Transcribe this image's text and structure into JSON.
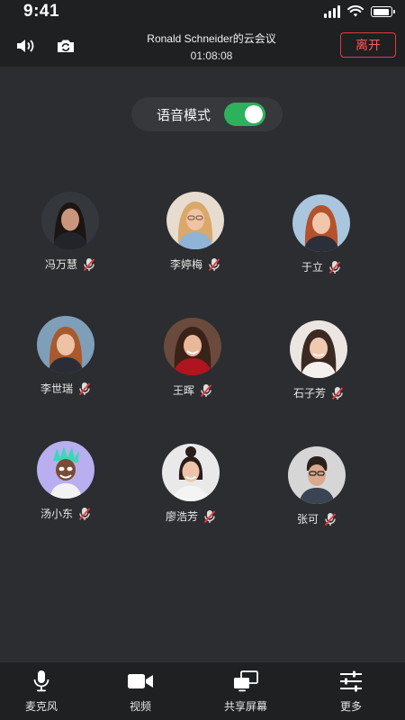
{
  "status_bar": {
    "time": "9:41"
  },
  "header": {
    "title": "Ronald Schneider的云会议",
    "timer": "01:08:08",
    "leave_label": "离开",
    "left_icons": [
      "speaker-icon",
      "switch-camera-icon"
    ]
  },
  "voice_mode": {
    "label": "语音模式",
    "enabled": true
  },
  "participants": [
    {
      "name": "冯万慧",
      "muted": true
    },
    {
      "name": "李婷梅",
      "muted": true
    },
    {
      "name": "于立",
      "muted": true
    },
    {
      "name": "李世瑞",
      "muted": true
    },
    {
      "name": "王晖",
      "muted": true
    },
    {
      "name": "石子芳",
      "muted": true
    },
    {
      "name": "汤小东",
      "muted": true
    },
    {
      "name": "廖浩芳",
      "muted": true
    },
    {
      "name": "张可",
      "muted": true
    }
  ],
  "toolbar": {
    "items": [
      {
        "label": "麦克风",
        "icon": "microphone-icon"
      },
      {
        "label": "视频",
        "icon": "video-camera-icon"
      },
      {
        "label": "共享屏幕",
        "icon": "share-screen-icon"
      },
      {
        "label": "更多",
        "icon": "more-settings-icon"
      }
    ]
  },
  "colors": {
    "accent_green": "#2db15a",
    "leave_red": "#e43a3a",
    "background": "#2b2d30"
  }
}
